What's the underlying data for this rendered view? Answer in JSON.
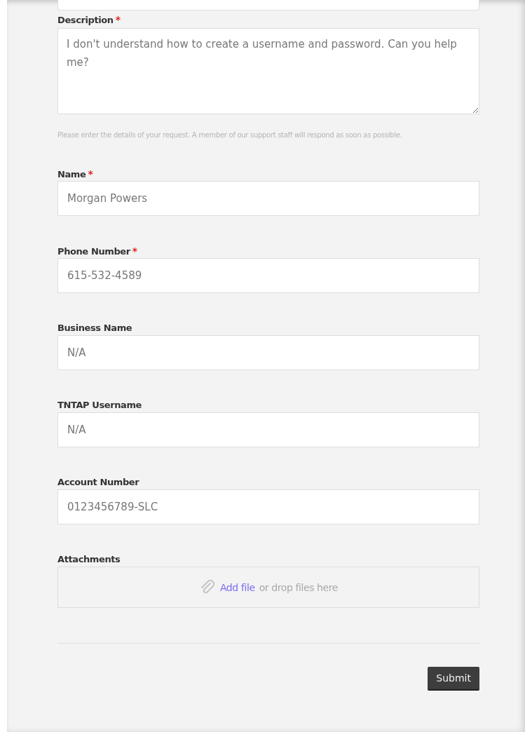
{
  "description": {
    "label": "Description",
    "required_mark": "*",
    "value": "I don't understand how to create a username and password. Can you help me?",
    "hint": "Please enter the details of your request. A member of our support staff will respond as soon as possible."
  },
  "fields": [
    {
      "label": "Name",
      "required_mark": "*",
      "value": "Morgan Powers"
    },
    {
      "label": "Phone Number",
      "required_mark": "*",
      "value": "615-532-4589"
    },
    {
      "label": "Business Name",
      "value": "N/A"
    },
    {
      "label": "TNTAP Username",
      "value": "N/A"
    },
    {
      "label": "Account Number",
      "value": "0123456789-SLC"
    }
  ],
  "attachments": {
    "label": "Attachments",
    "link": "Add file",
    "text": "or drop files here"
  },
  "submit": "Submit"
}
